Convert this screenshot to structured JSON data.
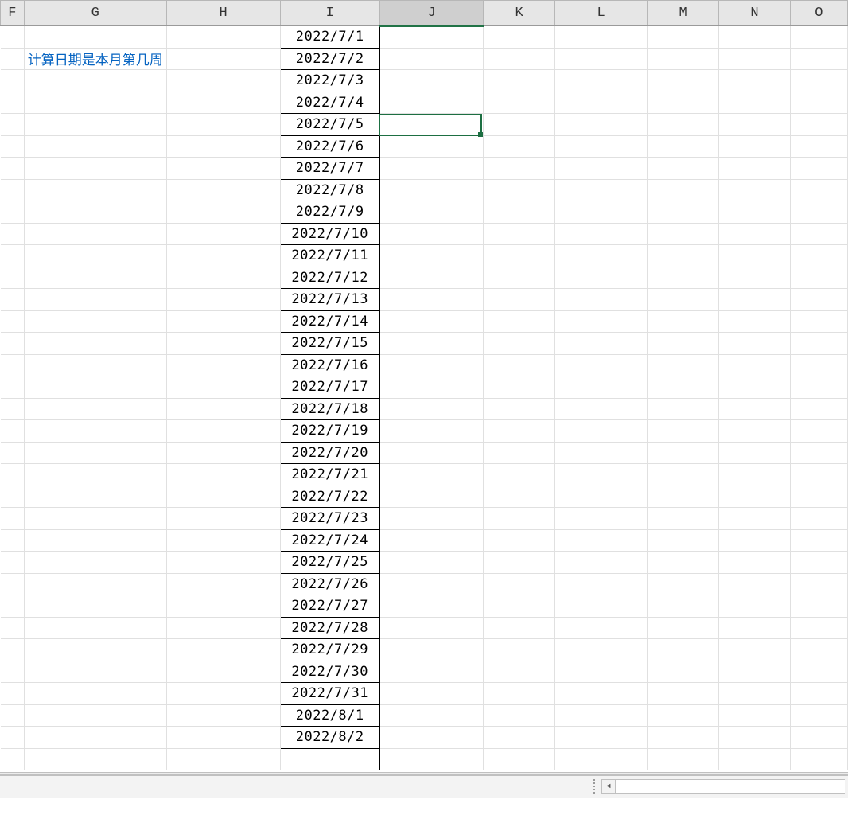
{
  "columns": [
    "F",
    "G",
    "H",
    "I",
    "J",
    "K",
    "L",
    "M",
    "N",
    "O"
  ],
  "selected_column": "J",
  "label_text": "计算日期是本月第几周",
  "dates": [
    "2022/7/1",
    "2022/7/2",
    "2022/7/3",
    "2022/7/4",
    "2022/7/5",
    "2022/7/6",
    "2022/7/7",
    "2022/7/8",
    "2022/7/9",
    "2022/7/10",
    "2022/7/11",
    "2022/7/12",
    "2022/7/13",
    "2022/7/14",
    "2022/7/15",
    "2022/7/16",
    "2022/7/17",
    "2022/7/18",
    "2022/7/19",
    "2022/7/20",
    "2022/7/21",
    "2022/7/22",
    "2022/7/23",
    "2022/7/24",
    "2022/7/25",
    "2022/7/26",
    "2022/7/27",
    "2022/7/28",
    "2022/7/29",
    "2022/7/30",
    "2022/7/31",
    "2022/8/1"
  ],
  "partial_next_date": "2022/8/2",
  "selected_cell": {
    "column": "J",
    "row_index": 4
  },
  "scroll": {
    "left_arrow": "◄"
  }
}
